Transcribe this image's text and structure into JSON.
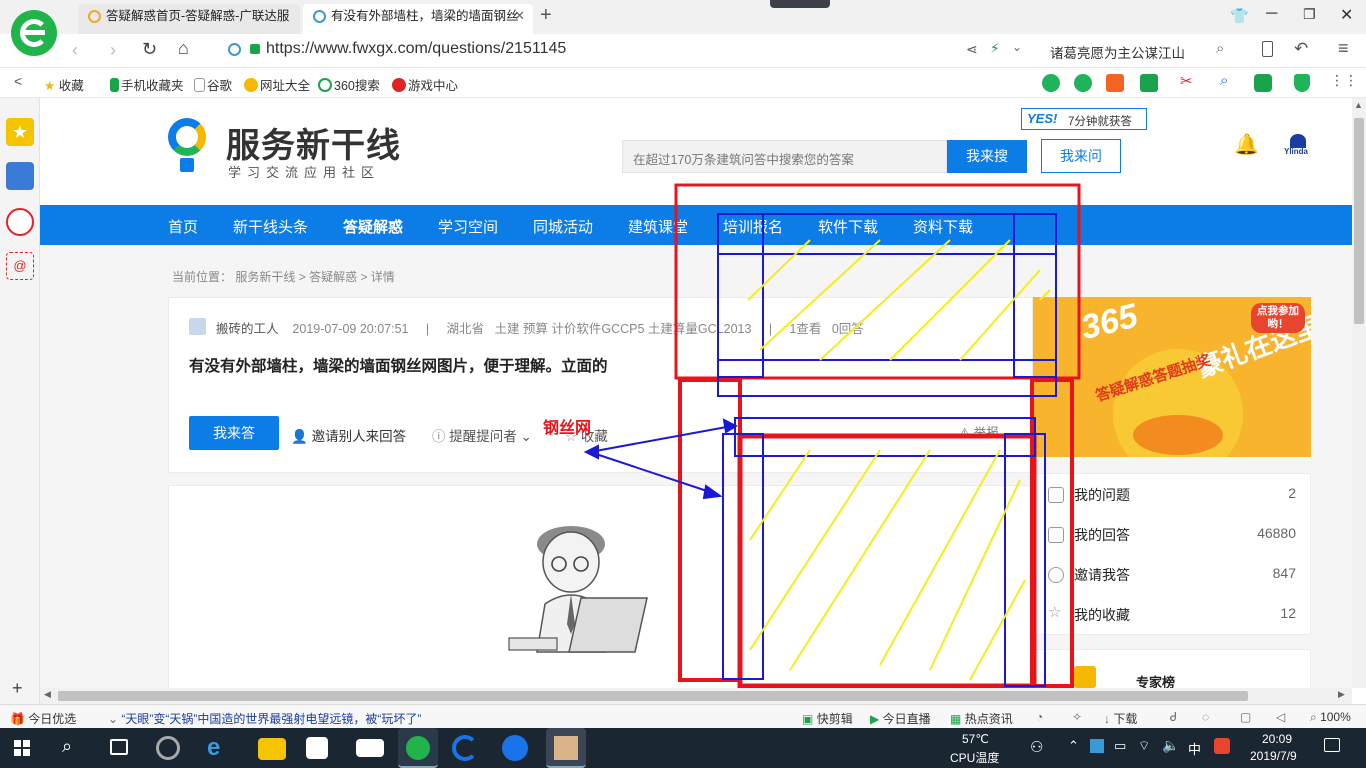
{
  "browser": {
    "tabs": [
      {
        "title": "答疑解惑首页-答疑解惑-广联达服"
      },
      {
        "title": "有没有外部墙柱，墙梁的墙面钢丝"
      }
    ],
    "url": "https://www.fwxgx.com/questions/2151145",
    "search_box": "诸葛亮愿为主公谋江山",
    "bookmarks": [
      "收藏",
      "手机收藏夹",
      "谷歌",
      "网址大全",
      "360搜索",
      "游戏中心"
    ]
  },
  "site": {
    "logo_main": "服务新干线",
    "logo_sub": "学习交流应用社区",
    "search_placeholder": "在超过170万条建筑问答中搜索您的答案",
    "search_button": "我来搜",
    "ask_button": "我来问",
    "yes_badge": "YES!",
    "yes_text": "7分钟就获答",
    "brand": "Ylinda",
    "nav": [
      "首页",
      "新干线头条",
      "答疑解惑",
      "学习空间",
      "同城活动",
      "建筑课堂",
      "培训报名",
      "软件下载",
      "资料下载"
    ],
    "breadcrumb": {
      "label": "当前位置：",
      "items": [
        "服务新干线",
        "答疑解惑",
        "详情"
      ],
      "sep": ">"
    }
  },
  "question": {
    "author": "搬砖的工人",
    "date": "2019-07-09 20:07:51",
    "sep": "|",
    "region": "湖北省",
    "tags": "土建 预算 计价软件GCCP5 土建算量GCL2013",
    "views": "1查看",
    "answers": "0回答",
    "title": "有没有外部墙柱，墙梁的墙面钢丝网图片，便于理解。立面的",
    "answer_button": "我来答",
    "invite": "邀请别人来回答",
    "remind": "提醒提问者",
    "collect": "收藏",
    "report": "举报"
  },
  "annotation": {
    "label": "钢丝网",
    "colors": {
      "red": "#e8141b",
      "blue": "#1a1ad6",
      "yellow": "#f2ef1a"
    }
  },
  "banner": {
    "text1": "豪礼在这里",
    "text2": "答疑解惑答题抽奖",
    "bubble": "点我参加哟！",
    "num": "365"
  },
  "stats": [
    {
      "label": "我的问题",
      "value": "2"
    },
    {
      "label": "我的回答",
      "value": "46880"
    },
    {
      "label": "邀请我答",
      "value": "847"
    },
    {
      "label": "我的收藏",
      "value": "12"
    }
  ],
  "experts": "专家榜",
  "statusbar": {
    "today": "今日优选",
    "news": "“天眼”变“天锅”中国造的世界最强射电望远镜，被“玩坏了”",
    "items": [
      "快剪辑",
      "今日直播",
      "热点资讯",
      "下载"
    ],
    "zoom": "100%"
  },
  "taskbar": {
    "temp": "57℃",
    "temp_label": "CPU温度",
    "ime": "中",
    "time": "20:09",
    "date": "2019/7/9"
  }
}
